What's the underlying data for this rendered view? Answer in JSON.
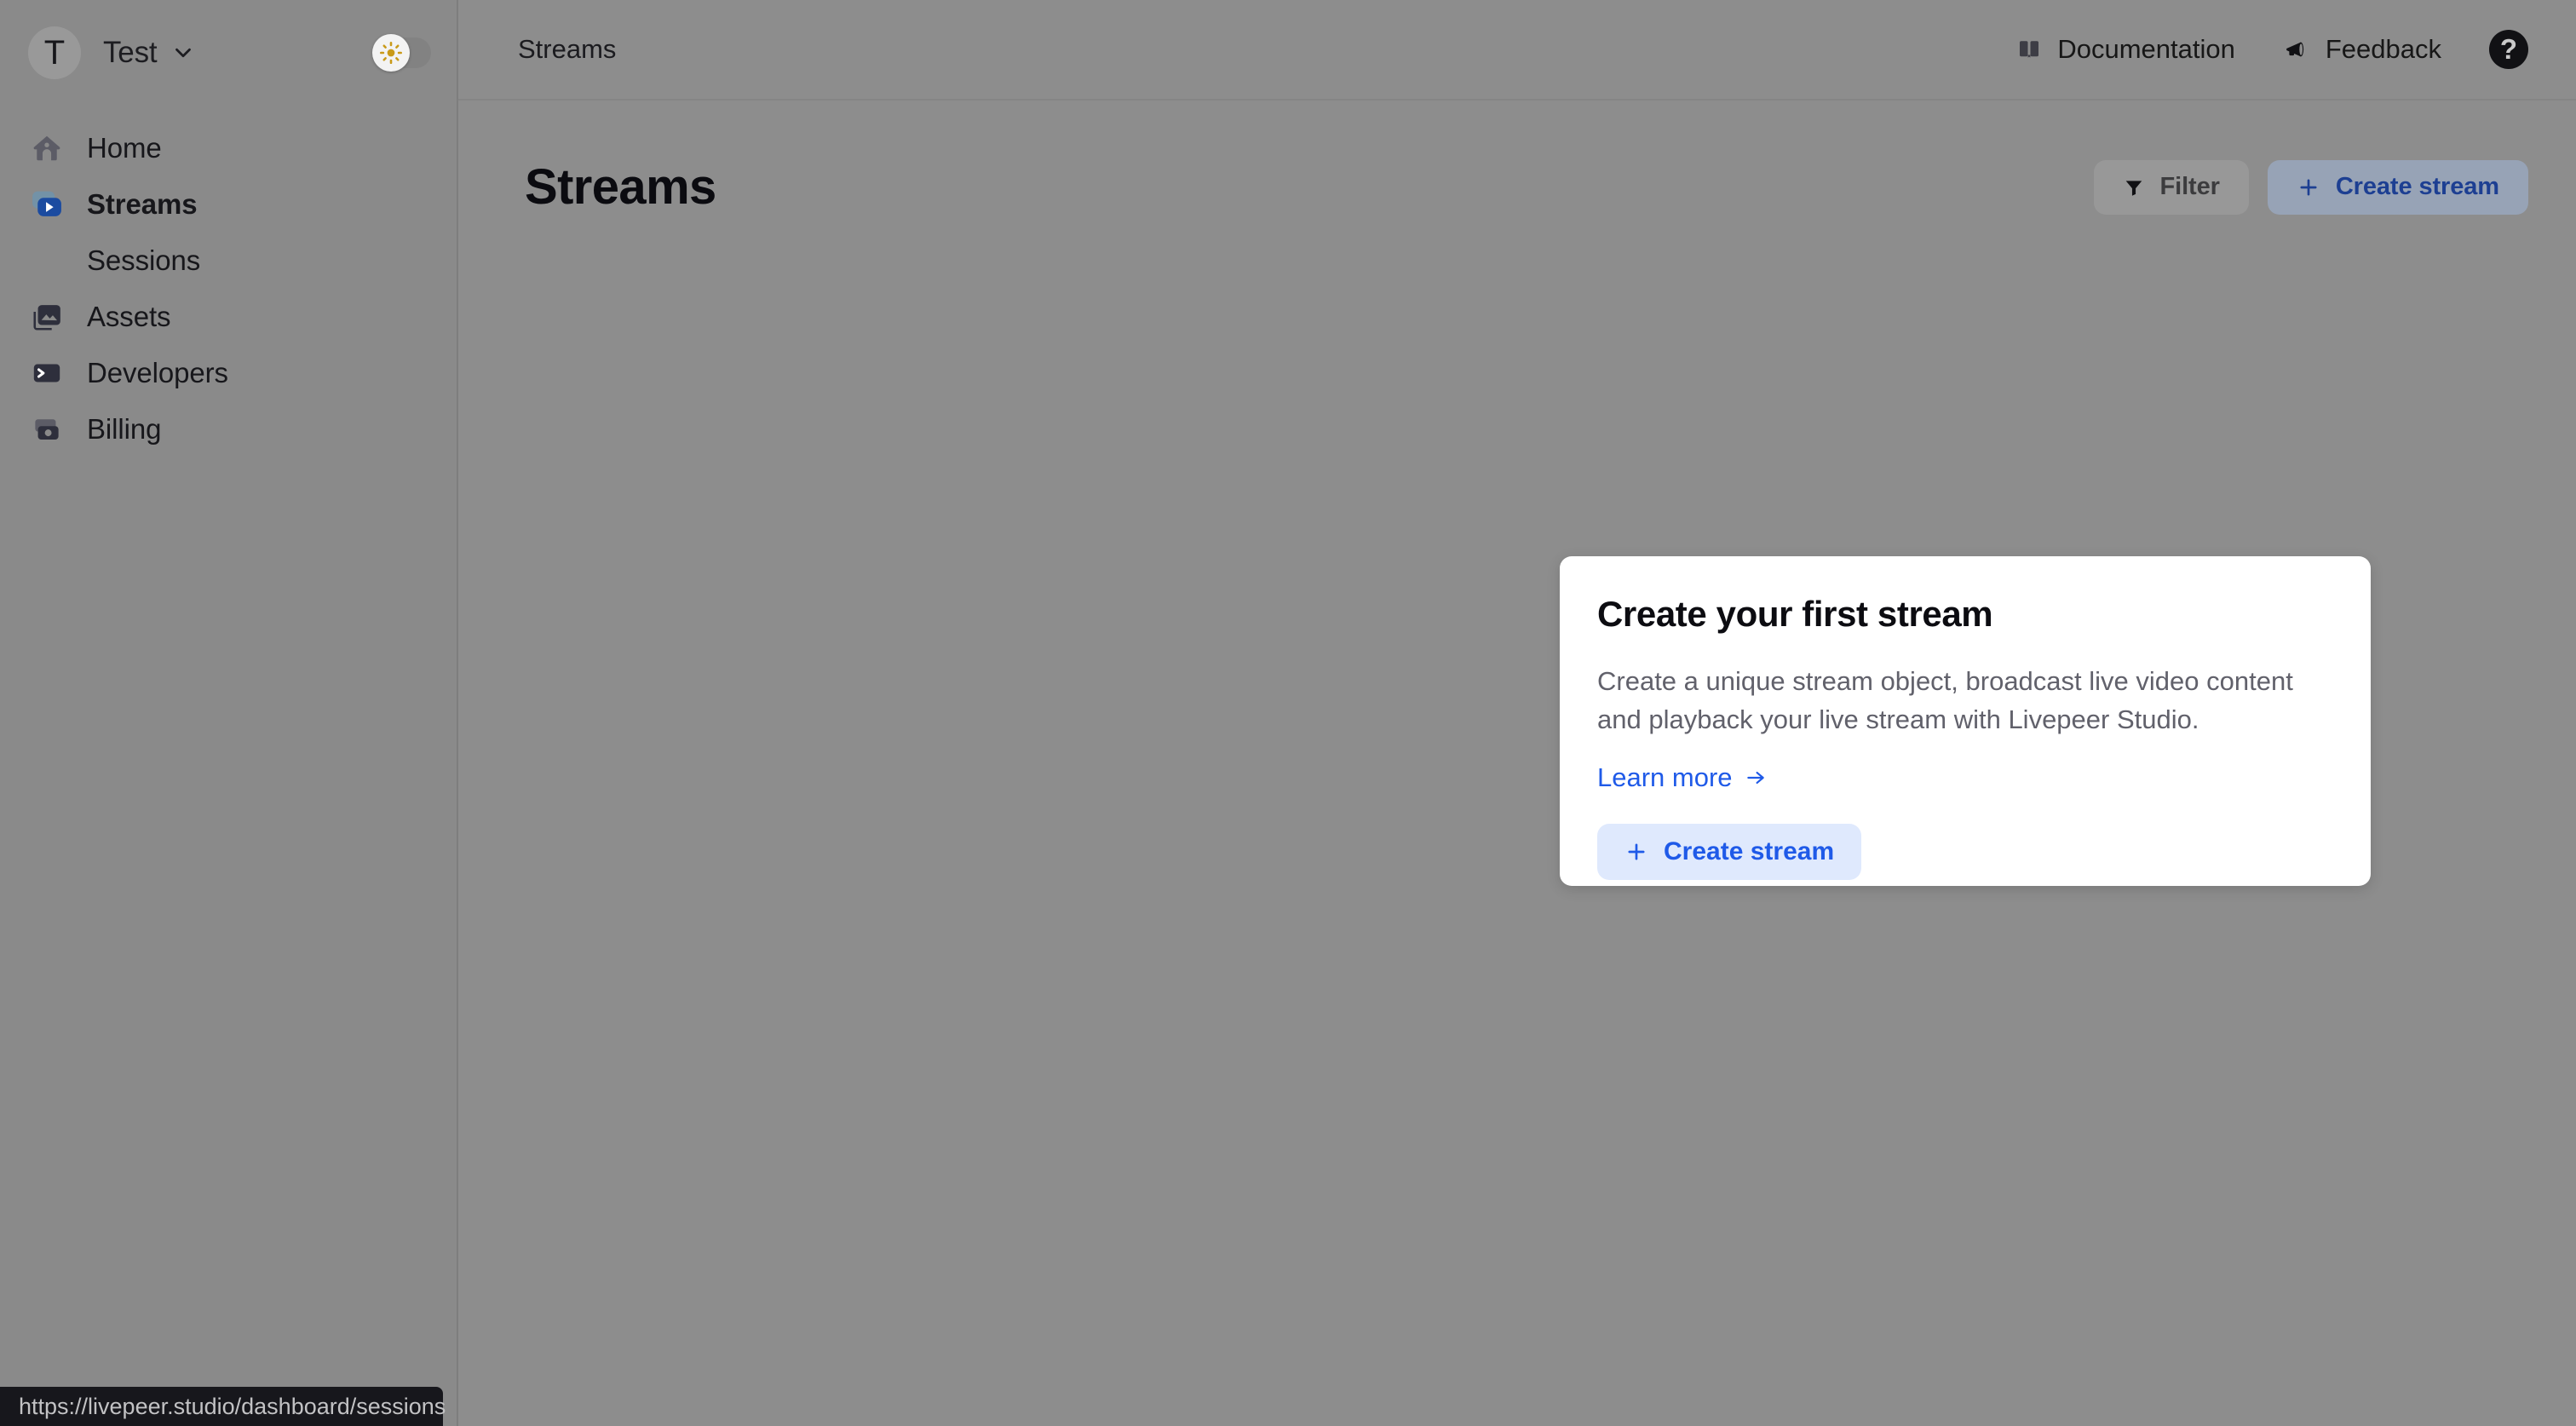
{
  "sidebar": {
    "org": {
      "avatar_initial": "T",
      "name": "Test",
      "chevron_icon": "chevron-down-icon"
    },
    "theme_toggle": {
      "icon": "sun-icon",
      "state": "light"
    },
    "items": [
      {
        "label": "Home",
        "icon": "home-icon",
        "active": false,
        "sub": false
      },
      {
        "label": "Streams",
        "icon": "video-play-icon",
        "active": true,
        "sub": false
      },
      {
        "label": "Sessions",
        "icon": "",
        "active": false,
        "sub": true
      },
      {
        "label": "Assets",
        "icon": "images-icon",
        "active": false,
        "sub": false
      },
      {
        "label": "Developers",
        "icon": "terminal-icon",
        "active": false,
        "sub": false
      },
      {
        "label": "Billing",
        "icon": "billing-icon",
        "active": false,
        "sub": false
      }
    ]
  },
  "topbar": {
    "breadcrumb": "Streams",
    "documentation_label": "Documentation",
    "documentation_icon": "book-icon",
    "feedback_label": "Feedback",
    "feedback_icon": "megaphone-icon",
    "help_icon": "question-mark-circle-icon",
    "help_glyph": "?"
  },
  "page": {
    "title": "Streams",
    "filter_label": "Filter",
    "filter_icon": "funnel-icon",
    "create_label": "Create stream",
    "create_icon": "plus-icon"
  },
  "card": {
    "title": "Create your first stream",
    "body": "Create a unique stream object, broadcast live video content and playback your live stream with Livepeer Studio.",
    "link_label": "Learn more",
    "link_icon": "arrow-right-icon",
    "button_label": "Create stream",
    "button_icon": "plus-icon"
  },
  "statusbar": {
    "url": "https://livepeer.studio/dashboard/sessions"
  },
  "colors": {
    "accent_blue": "#1f5ae8",
    "accent_blue_soft": "#dfe9fd",
    "page_bg": "#8d8d8d",
    "sidebar_bg": "#8a8a8a",
    "card_bg": "#ffffff",
    "status_bg": "#17171c",
    "sun_yellow": "#c99a18"
  }
}
